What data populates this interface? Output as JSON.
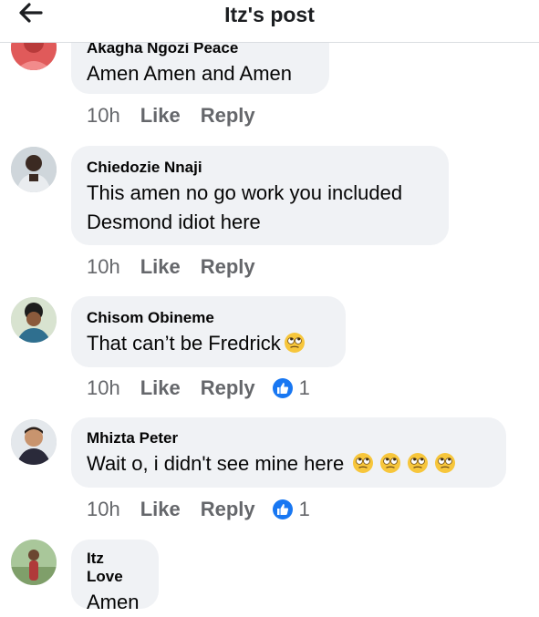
{
  "header": {
    "title": "Itz's post",
    "back_icon": "back-arrow-icon"
  },
  "comments": [
    {
      "name": "Akagha Ngozi Peace",
      "text": "Amen Amen and Amen",
      "emoji_count": 0,
      "time": "10h",
      "like": "Like",
      "reply": "Reply",
      "reactions": ""
    },
    {
      "name": "Chiedozie Nnaji",
      "text_line1": "This amen no go work you included",
      "text_line2": "Desmond idiot here",
      "emoji_count": 0,
      "time": "10h",
      "like": "Like",
      "reply": "Reply",
      "reactions": ""
    },
    {
      "name": "Chisom Obineme",
      "text": "That can’t be Fredrick",
      "emoji": "face-with-rolling-eyes",
      "emoji_count": 1,
      "time": "10h",
      "like": "Like",
      "reply": "Reply",
      "reactions": "1",
      "reaction_icon": "thumbs-up-icon"
    },
    {
      "name": "Mhizta Peter",
      "text": "Wait o, i didn't see mine here",
      "emoji": "face-with-rolling-eyes",
      "emoji_count": 4,
      "time": "10h",
      "like": "Like",
      "reply": "Reply",
      "reactions": "1",
      "reaction_icon": "thumbs-up-icon"
    },
    {
      "name": "Itz Love",
      "text": "Amen",
      "emoji_count": 0
    }
  ],
  "colors": {
    "bubble": "#f0f2f5",
    "meta": "#65676b",
    "like_badge": "#1877f2",
    "emoji": "#f7c63b"
  }
}
